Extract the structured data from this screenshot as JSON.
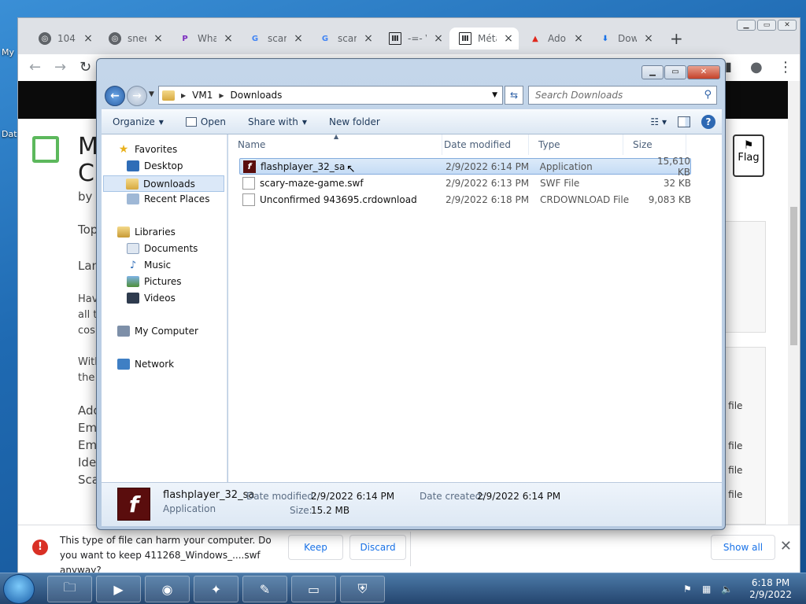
{
  "desktop": {
    "label_my": "My",
    "label_dat": "Dat"
  },
  "chrome": {
    "tabs": [
      {
        "title": "104…",
        "icon": "globe-icon",
        "color": "#5f6368"
      },
      {
        "title": "snee",
        "icon": "globe-icon",
        "color": "#5f6368"
      },
      {
        "title": "What",
        "icon": "picsart-icon",
        "color": "#7b2cbf"
      },
      {
        "title": "scary",
        "icon": "google-icon",
        "color": "#4285f4"
      },
      {
        "title": "scary",
        "icon": "google-icon",
        "color": "#4285f4"
      },
      {
        "title": "-=- V",
        "icon": "museum-icon",
        "color": "#202124"
      },
      {
        "title": "Méta",
        "icon": "museum-icon",
        "color": "#202124"
      },
      {
        "title": "Adob",
        "icon": "adobe-icon",
        "color": "#e0281c"
      },
      {
        "title": "Dow",
        "icon": "download-icon",
        "color": "#1a73e8"
      }
    ],
    "page_snippets": {
      "t1": "M",
      "t2": "C",
      "by": "by",
      "top": "Top",
      "lan": "Lan",
      "hav": "Hav",
      "all": "all t",
      "cos": "cos",
      "wit": "With",
      "the": "the",
      "add": "Add",
      "em1": "Em",
      "em2": "Em",
      "ide": "Ide",
      "sca": "Sca",
      "file1": "l file",
      "file2": "l file",
      "file3": "l file",
      "file4": "l file",
      "flag": "Flag"
    }
  },
  "download_bar": {
    "message": "This type of file can harm your computer. Do you want to keep 411268_Windows_....swf anyway?",
    "keep": "Keep",
    "discard": "Discard",
    "show_all": "Show all"
  },
  "explorer": {
    "breadcrumb": [
      "VM1",
      "Downloads"
    ],
    "search_placeholder": "Search Downloads",
    "toolbar": {
      "organize": "Organize",
      "open": "Open",
      "share": "Share with",
      "new_folder": "New folder"
    },
    "nav": {
      "favorites": "Favorites",
      "desktop": "Desktop",
      "downloads": "Downloads",
      "recent": "Recent Places",
      "libraries": "Libraries",
      "documents": "Documents",
      "music": "Music",
      "pictures": "Pictures",
      "videos": "Videos",
      "computer": "My Computer",
      "network": "Network"
    },
    "columns": {
      "name": "Name",
      "date": "Date modified",
      "type": "Type",
      "size": "Size"
    },
    "files": [
      {
        "name": "flashplayer_32_sa",
        "date": "2/9/2022 6:14 PM",
        "type": "Application",
        "size": "15,610 KB"
      },
      {
        "name": "scary-maze-game.swf",
        "date": "2/9/2022 6:13 PM",
        "type": "SWF File",
        "size": "32 KB"
      },
      {
        "name": "Unconfirmed 943695.crdownload",
        "date": "2/9/2022 6:18 PM",
        "type": "CRDOWNLOAD File",
        "size": "9,083 KB"
      }
    ],
    "details": {
      "name": "flashplayer_32_sa",
      "kind": "Application",
      "date_modified_label": "Date modified:",
      "date_modified": "2/9/2022 6:14 PM",
      "date_created_label": "Date created:",
      "date_created": "2/9/2022 6:14 PM",
      "size_label": "Size:",
      "size": "15.2 MB"
    }
  },
  "taskbar": {
    "time": "6:18 PM",
    "date": "2/9/2022"
  }
}
